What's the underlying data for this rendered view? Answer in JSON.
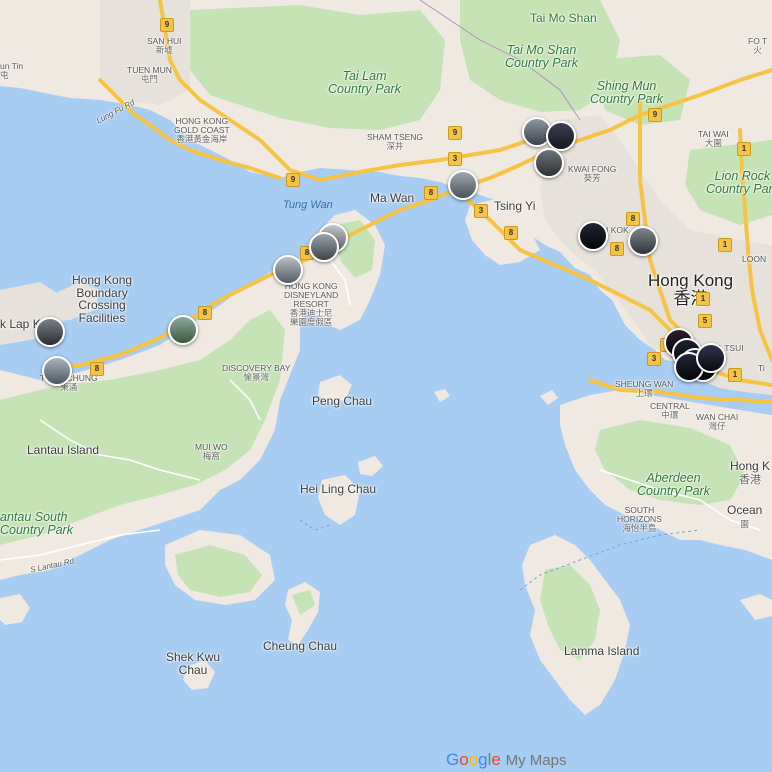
{
  "map": {
    "labels": {
      "san_hui": "SAN HUI",
      "san_hui_zh": "新墟",
      "tuen_mun": "TUEN MUN",
      "tuen_mun_zh": "屯門",
      "lung_fu_rd": "Lung Fu Rd",
      "hk_gold_coast": "HONG KONG\nGOLD COAST",
      "hk_gold_coast_zh": "香港黃金海岸",
      "tai_lam": "Tai Lam\nCountry Park",
      "tai_mo_shan": "Tai Mo Shan",
      "tai_mo_shan_park": "Tai Mo Shan\nCountry Park",
      "shing_mun": "Shing Mun\nCountry Park",
      "sham_tseng": "SHAM TSENG",
      "sham_tseng_zh": "深井",
      "tai_wai": "TAI WAI",
      "tai_wai_zh": "大圍",
      "kwai_fong": "KWAI FONG",
      "kwai_fong_zh": "葵芳",
      "tung_wan": "Tung Wan",
      "ma_wan": "Ma Wan",
      "tsing_yi": "Tsing Yi",
      "lion_rock": "Lion Rock\nCountry Park",
      "hong_kong": "Hong Kong",
      "hong_kong_zh": "香港",
      "boundary": "Hong Kong\nBoundary\nCrossing\nFacilities",
      "chek_lap_kok": "k Lap K",
      "disneyland": "HONG KONG\nDISNEYLAND\nRESORT",
      "disneyland_zh": "香港迪士尼\n樂園度假區",
      "discovery_bay": "DISCOVERY BAY",
      "discovery_bay_zh": "愉景灣",
      "tung_chung": "TUNG CHUNG",
      "tung_chung_zh": "東涌",
      "peng_chau": "Peng Chau",
      "lantau_island": "Lantau Island",
      "mui_wo": "MUI WO",
      "mui_wo_zh": "梅窩",
      "tsim_sha_tsui": "SHA TSUI",
      "sheung_wan": "SHEUNG WAN",
      "sheung_wan_zh": "上環",
      "central": "CENTRAL",
      "central_zh": "中環",
      "wan_chai": "WAN CHAI",
      "wan_chai_zh": "灣仔",
      "hei_ling_chau": "Hei Ling Chau",
      "aberdeen": "Aberdeen\nCountry Park",
      "hong_kong_island": "Hong K",
      "hong_kong_island_zh": "香港",
      "lantau_south": "antau South\nCountry Park",
      "south_lantau_rd": "S Lantau Rd",
      "south_horizons": "SOUTH\nHORIZONS",
      "south_horizons_zh": "海怡半島",
      "ocean_park": "Ocean",
      "ocean_park_zh": "園",
      "cheung_chau": "Cheung Chau",
      "shek_kwu_chau": "Shek Kwu\nChau",
      "lamma_island": "Lamma Island",
      "fo_tan": "FO T",
      "fo_tan_zh": "火",
      "ts_label": "Ti",
      "kowloon_label": "LOON",
      "un_tin": "un Tin\n屯",
      "kok_label": "I KOK"
    },
    "shields": [
      "9",
      "9",
      "9",
      "9",
      "3",
      "3",
      "8",
      "8",
      "8",
      "8",
      "8",
      "8",
      "1",
      "1",
      "1",
      "1",
      "1",
      "5",
      "3",
      "8",
      "3"
    ],
    "colors": {
      "water": "#a7cdf2",
      "land": "#efe9e1",
      "park": "#c5e3b4",
      "urban": "#e6e1da",
      "highway": "#f6c344"
    },
    "markers_count": 18
  },
  "logo": {
    "google": "Google",
    "my_maps": "My Maps"
  }
}
